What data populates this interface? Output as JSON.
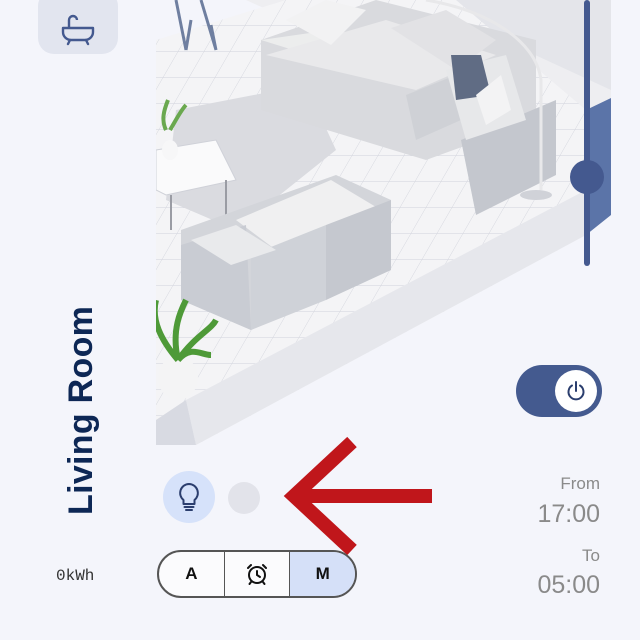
{
  "room": {
    "name": "Living Room"
  },
  "energy": {
    "value": "0kWh"
  },
  "modes": [
    {
      "label": "A",
      "active": false
    },
    {
      "label": "",
      "icon": "alarm-clock-icon",
      "active": false
    },
    {
      "label": "M",
      "active": true
    }
  ],
  "schedule": {
    "from_label": "From",
    "from_time": "17:00",
    "to_label": "To",
    "to_time": "05:00"
  },
  "power": {
    "on": true
  },
  "colors": {
    "accent": "#44598f",
    "title": "#0d2755",
    "active_mode": "#d5e0f8",
    "arrow": "#c0161b"
  }
}
